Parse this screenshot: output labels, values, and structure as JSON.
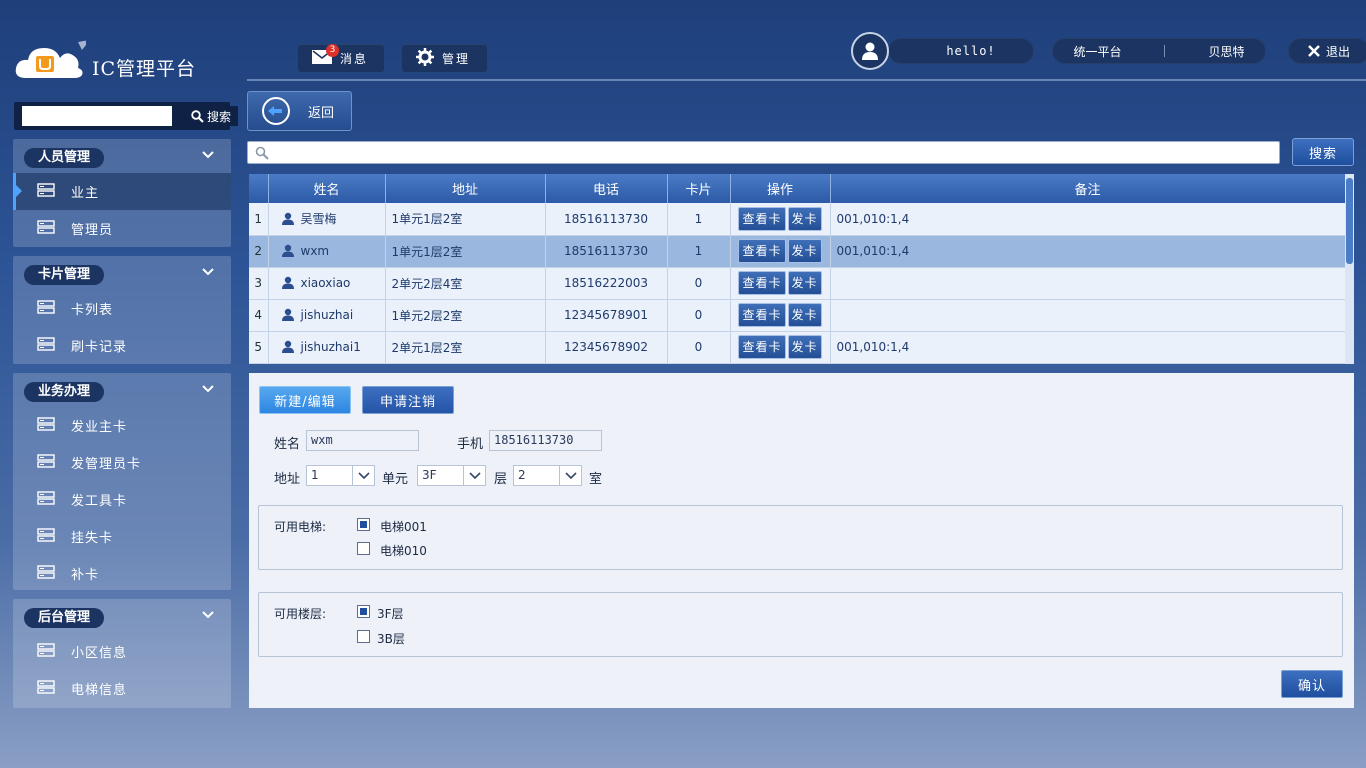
{
  "brand": {
    "title": "IC管理平台"
  },
  "header": {
    "messages_label": "消息",
    "messages_badge": "3",
    "manage_label": "管理",
    "greeting": "hello!",
    "platform_label": "统一平台",
    "company_label": "贝思特",
    "logout_label": "退出"
  },
  "sidebar": {
    "search_placeholder": "",
    "search_label": "搜索",
    "groups": [
      {
        "title": "人员管理",
        "items": [
          {
            "label": "业主",
            "active": true
          },
          {
            "label": "管理员"
          }
        ]
      },
      {
        "title": "卡片管理",
        "items": [
          {
            "label": "卡列表"
          },
          {
            "label": "刷卡记录"
          }
        ]
      },
      {
        "title": "业务办理",
        "items": [
          {
            "label": "发业主卡"
          },
          {
            "label": "发管理员卡"
          },
          {
            "label": "发工具卡"
          },
          {
            "label": "挂失卡"
          },
          {
            "label": "补卡"
          }
        ]
      },
      {
        "title": "后台管理",
        "items": [
          {
            "label": "小区信息"
          },
          {
            "label": "电梯信息"
          }
        ]
      }
    ]
  },
  "main": {
    "back_label": "返回",
    "search_placeholder": "",
    "search_label": "搜索",
    "table": {
      "columns": [
        "姓名",
        "地址",
        "电话",
        "卡片",
        "操作",
        "备注"
      ],
      "view_card_label": "查看卡",
      "issue_card_label": "发卡",
      "rows": [
        {
          "index": "1",
          "name": "吴雪梅",
          "address": "1单元1层2室",
          "phone": "18516113730",
          "cards": "1",
          "note": "001,010:1,4"
        },
        {
          "index": "2",
          "name": "wxm",
          "address": "1单元1层2室",
          "phone": "18516113730",
          "cards": "1",
          "note": "001,010:1,4",
          "selected": true
        },
        {
          "index": "3",
          "name": "xiaoxiao",
          "address": "2单元2层4室",
          "phone": "18516222003",
          "cards": "0",
          "note": ""
        },
        {
          "index": "4",
          "name": "jishuzhai",
          "address": "1单元2层2室",
          "phone": "12345678901",
          "cards": "0",
          "note": ""
        },
        {
          "index": "5",
          "name": "jishuzhai1",
          "address": "2单元1层2室",
          "phone": "12345678902",
          "cards": "0",
          "note": "001,010:1,4"
        }
      ]
    },
    "form": {
      "new_edit_label": "新建/编辑",
      "apply_cancel_label": "申请注销",
      "name_label": "姓名",
      "name_value": "wxm",
      "phone_label": "手机",
      "phone_value": "18516113730",
      "address_label": "地址",
      "unit_select": "1",
      "unit_label": "单元",
      "floor_select": "3F",
      "floor_label": "层",
      "room_select": "2",
      "room_label": "室",
      "elevators_label": "可用电梯:",
      "elevators": [
        {
          "label": "电梯001",
          "checked": true
        },
        {
          "label": "电梯010",
          "checked": false
        }
      ],
      "floors_label": "可用楼层:",
      "floors": [
        {
          "label": "3F层",
          "checked": true
        },
        {
          "label": "3B层",
          "checked": false
        }
      ],
      "confirm_label": "确认"
    }
  }
}
